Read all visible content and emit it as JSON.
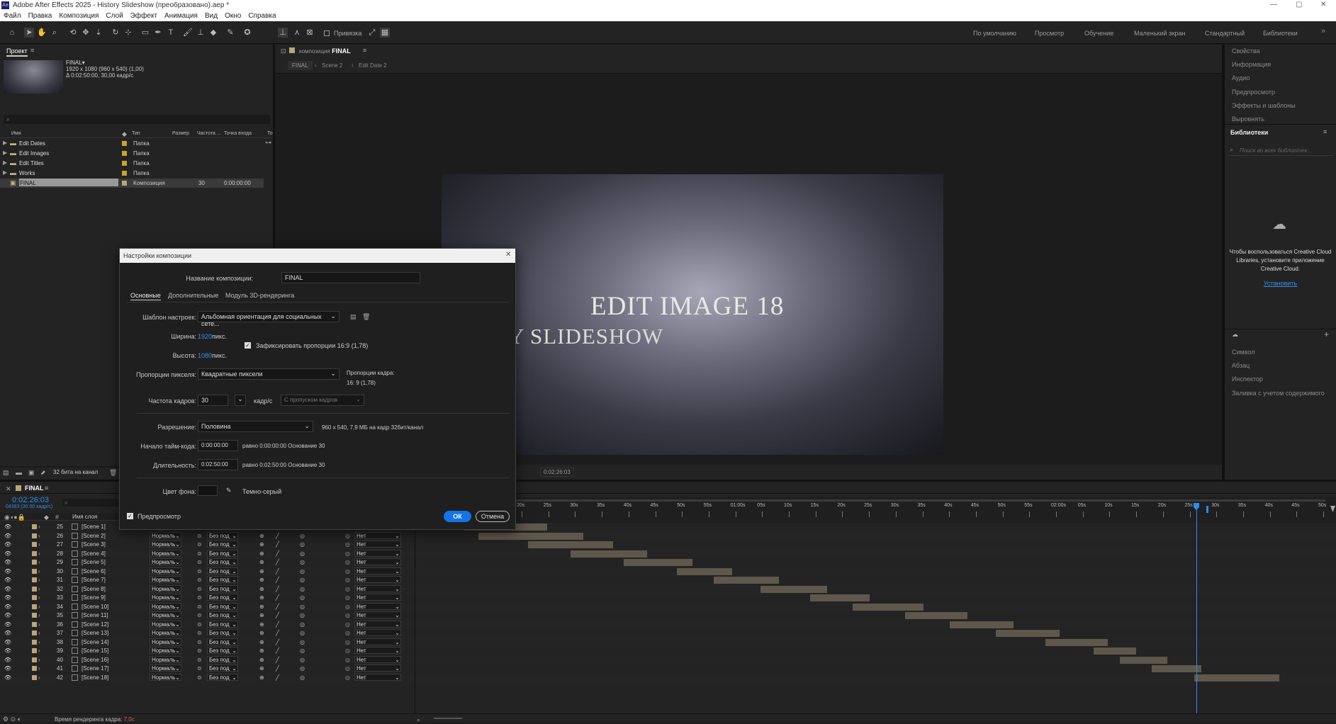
{
  "titlebar": {
    "title": "Adobe After Effects 2025 - History Slideshow (преобразовано).aep *",
    "app_icon": "Ae"
  },
  "menu": [
    "Файл",
    "Правка",
    "Композиция",
    "Слой",
    "Эффект",
    "Анимация",
    "Вид",
    "Окно",
    "Справка"
  ],
  "toolbar": {
    "snapping": "Привязка",
    "workspaces": [
      "По умолчанию",
      "Просмотр",
      "Обучение",
      "Маленький экран",
      "Стандартный",
      "Библиотеки"
    ]
  },
  "project": {
    "tab": "Проект",
    "item_name": "FINAL▾",
    "item_dims": "1920 x 1080 (960 x 540) (1,00)",
    "item_duration": "Δ 0:02:50:00, 30,00 кадр/с",
    "search_placeholder": "",
    "columns": [
      "Имя",
      "Тип",
      "Размер",
      "Частота ...",
      "Точка входа",
      "То"
    ],
    "rows": [
      {
        "name": "Edit Dates",
        "type": "Папка",
        "rate": "",
        "in": "",
        "color": "#c9a227"
      },
      {
        "name": "Edit Images",
        "type": "Папка",
        "rate": "",
        "in": "",
        "color": "#c9a227"
      },
      {
        "name": "Edit Titles",
        "type": "Папка",
        "rate": "",
        "in": "",
        "color": "#c9a227"
      },
      {
        "name": "Works",
        "type": "Папка",
        "rate": "",
        "in": "",
        "color": "#c9a227"
      },
      {
        "name": "FINAL",
        "type": "Композиция",
        "rate": "30",
        "in": "0:00:00:00",
        "color": "#b9a57a"
      }
    ],
    "bpc": "32 бита на канал"
  },
  "composition": {
    "tab_prefix": "композиция",
    "tab_name": "FINAL",
    "breadcrumbs": [
      "FINAL",
      "Scene 2",
      "Edit Date 2"
    ],
    "frame_title": "EDIT IMAGE 18",
    "frame_subtitle": "Y SLIDESHOW",
    "timecode": "0:02:26:03"
  },
  "right_panel": {
    "items_top": [
      "Свойства",
      "Информация",
      "Аудио",
      "Предпросмотр",
      "Эффекты и шаблоны",
      "Выровнять"
    ],
    "libraries_title": "Библиотеки",
    "search_placeholder": "Поиск во всех библиотек...",
    "cc_message": "Чтобы воспользоваться Creative Cloud Libraries, установите приложение Creative Cloud.",
    "install_link": "Установить",
    "items_bottom": [
      "Символ",
      "Абзац",
      "Инспектор",
      "Заливка с учетом содержимого"
    ]
  },
  "timeline": {
    "tab": "FINAL",
    "timecode": "0:02:26:03",
    "frames": "04383 (30.00 кадр/с)",
    "layer_name_header": "Имя слоя",
    "ruler_labels": [
      "20s",
      "25s",
      "30s",
      "35s",
      "40s",
      "45s",
      "50s",
      "55s",
      "01:00s",
      "05s",
      "10s",
      "15s",
      "20s",
      "25s",
      "30s",
      "35s",
      "40s",
      "45s",
      "50s",
      "55s",
      "02:00s",
      "05s",
      "10s",
      "15s",
      "20s",
      "25s",
      "30s",
      "35s",
      "40s",
      "45s",
      "50s"
    ],
    "mode": "Нормаль",
    "trkmat": "Без под",
    "parent": "Нет",
    "layers": [
      {
        "num": "25",
        "name": "[Scene 1]",
        "start": 0.0,
        "end": 0.117
      },
      {
        "num": "26",
        "name": "[Scene 2]",
        "start": 0.02,
        "end": 0.168
      },
      {
        "num": "27",
        "name": "[Scene 3]",
        "start": 0.09,
        "end": 0.21
      },
      {
        "num": "28",
        "name": "[Scene 4]",
        "start": 0.15,
        "end": 0.258
      },
      {
        "num": "29",
        "name": "[Scene 5]",
        "start": 0.225,
        "end": 0.322
      },
      {
        "num": "30",
        "name": "[Scene 6]",
        "start": 0.3,
        "end": 0.378
      },
      {
        "num": "31",
        "name": "[Scene 7]",
        "start": 0.352,
        "end": 0.444
      },
      {
        "num": "32",
        "name": "[Scene 8]",
        "start": 0.418,
        "end": 0.512
      },
      {
        "num": "33",
        "name": "[Scene 9]",
        "start": 0.488,
        "end": 0.572
      },
      {
        "num": "34",
        "name": "[Scene 10]",
        "start": 0.548,
        "end": 0.648
      },
      {
        "num": "35",
        "name": "[Scene 11]",
        "start": 0.622,
        "end": 0.71
      },
      {
        "num": "36",
        "name": "[Scene 12]",
        "start": 0.685,
        "end": 0.775
      },
      {
        "num": "37",
        "name": "[Scene 13]",
        "start": 0.75,
        "end": 0.84
      },
      {
        "num": "38",
        "name": "[Scene 14]",
        "start": 0.82,
        "end": 0.908
      },
      {
        "num": "39",
        "name": "[Scene 15]",
        "start": 0.888,
        "end": 0.948
      },
      {
        "num": "40",
        "name": "[Scene 16]",
        "start": 0.925,
        "end": 0.992
      },
      {
        "num": "41",
        "name": "[Scene 17]",
        "start": 0.97,
        "end": 1.04
      },
      {
        "num": "42",
        "name": "[Scene 18]",
        "start": 1.03,
        "end": 1.15
      }
    ],
    "footer": "Время рендеринга кадра:",
    "footer_value": "7,0с"
  },
  "dialog": {
    "title": "Настройки композиции",
    "name_label": "Название композиции:",
    "name_value": "FINAL",
    "tabs": [
      "Основные",
      "Дополнительные",
      "Модуль 3D-рендеринга"
    ],
    "preset_label": "Шаблон настроек:",
    "preset_value": "Альбомная ориентация для социальных сете...",
    "width_label": "Ширина:",
    "width_value": "1920",
    "height_label": "Высота:",
    "height_value": "1080",
    "px_unit": "пикс.",
    "lock_label": "Зафиксировать пропорции 16:9 (1,78)",
    "lock_checked": true,
    "pixel_aspect_label": "Пропорции пикселя:",
    "pixel_aspect_value": "Квадратные пиксели",
    "frame_aspect_label": "Пропорции кадра:",
    "frame_aspect_value": "16: 9 (1,78)",
    "fps_label": "Частота кадров:",
    "fps_value": "30",
    "fps_unit": "кадр/с",
    "drop_frame": "С пропуском кадров",
    "resolution_label": "Разрешение:",
    "resolution_value": "Половина",
    "resolution_info": "960 x 540, 7,9 МБ на кадр 32бит/канал",
    "start_tc_label": "Начало тайм-кода:",
    "start_tc_value": "0:00:00:00",
    "start_tc_info": "равно 0:00:00:00  Основание 30",
    "duration_label": "Длительность:",
    "duration_value": "0:02:50:00",
    "duration_info": "равно 0:02:50:00  Основание 30",
    "bg_label": "Цвет фона:",
    "bg_name": "Темно-серый",
    "bg_color": "#121212",
    "preview_label": "Предпросмотр",
    "ok": "ОК",
    "cancel": "Отмена"
  },
  "colors": {
    "accent": "#1473e6",
    "link": "#3b8eea",
    "timecode": "#2d8ceb"
  }
}
